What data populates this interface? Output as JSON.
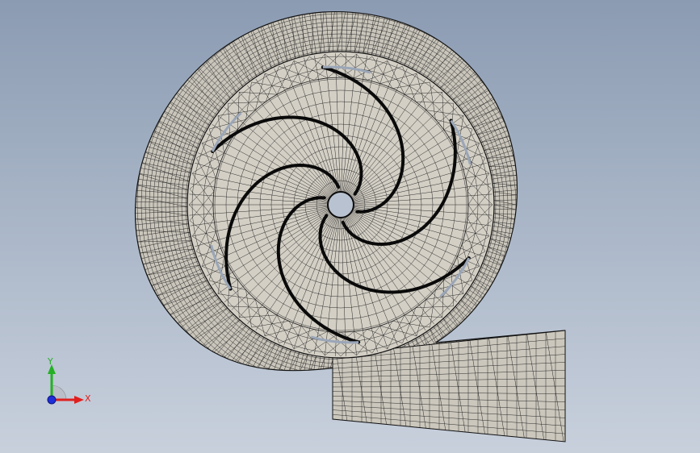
{
  "viewport": {
    "name": "cad-graphics-viewport",
    "model": "centrifugal-pump-volute-mesh",
    "colors": {
      "background_top": "#8b9bb2",
      "background_bottom": "#c8d0dc",
      "mesh_fill": "#cfcbc0",
      "mesh_line": "#141414",
      "blade_highlight": "#9aa6b8"
    }
  },
  "triad": {
    "x_label": "X",
    "y_label": "Y",
    "x_color": "#e0201e",
    "y_color": "#24b024",
    "z_color": "#1e2ed8"
  },
  "impeller": {
    "blade_count": 6
  }
}
